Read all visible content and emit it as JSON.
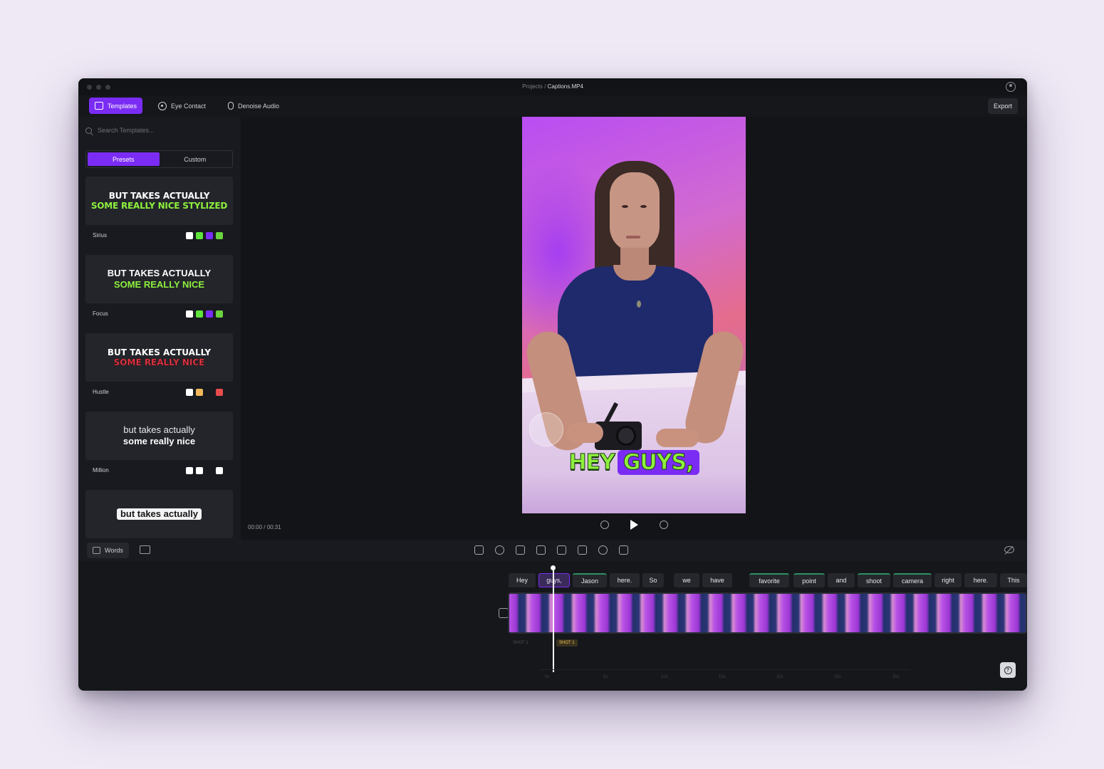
{
  "window": {
    "breadcrumb_root": "Projects /",
    "breadcrumb_file": "Captions.MP4"
  },
  "toolbar": {
    "templates_label": "Templates",
    "eye_contact_label": "Eye Contact",
    "denoise_label": "Denoise Audio",
    "export_label": "Export"
  },
  "sidebar": {
    "search_placeholder": "Search Templates...",
    "tabs": {
      "presets": "Presets",
      "custom": "Custom"
    },
    "templates": [
      {
        "name": "Sirius",
        "line1": "BUT TAKES ACTUALLY",
        "line2": "SOME REALLY NICE STYLIZED",
        "line1_color": "#ffffff",
        "line2_color": "#8ef03d",
        "swatches": [
          "#ffffff",
          "#5ee43a",
          "#7b2cf4",
          "#6bd33d"
        ]
      },
      {
        "name": "Focus",
        "line1": "BUT TAKES ACTUALLY",
        "line2": "SOME REALLY NICE",
        "line1_color": "#ffffff",
        "line2_color": "#8ef03d",
        "swatches": [
          "#ffffff",
          "#5ee43a",
          "#7b2cf4",
          "#6bd33d"
        ]
      },
      {
        "name": "Hustle",
        "line1": "BUT TAKES ACTUALLY",
        "line2": "SOME REALLY NICE",
        "line1_color": "#ffffff",
        "line2_color": "#ef3b4a",
        "swatches": [
          "#ffffff",
          "#f0b75a",
          "",
          "#e74c4c"
        ]
      },
      {
        "name": "Million",
        "line1": "but takes actually",
        "line2": "some really nice",
        "line1_color": "#e8e8ea",
        "line2_color": "#ffffff",
        "swatches": [
          "#ffffff",
          "#ffffff",
          "",
          "#ffffff"
        ]
      },
      {
        "name": "",
        "line1": "but takes actually",
        "line2": "",
        "line1_color": "#16161a",
        "line2_color": "#ffffff",
        "swatches": []
      }
    ]
  },
  "player": {
    "caption_word1": "HEY",
    "caption_word2": "GUYS,",
    "timecode": "00:00 / 00:31"
  },
  "timeline": {
    "words_label": "Words",
    "words": [
      "Hey",
      "guys,",
      "Jason",
      "here.",
      "So",
      "we",
      "have",
      "favorite",
      "point",
      "and",
      "shoot",
      "camera",
      "right",
      "here.",
      "This"
    ],
    "shot_prev": "SHOT 1",
    "shot_current": "SHOT 1",
    "ruler": [
      "0s",
      "5s",
      "10s",
      "15s",
      "20s",
      "25s",
      "30s"
    ]
  },
  "icons": {
    "help": "?"
  }
}
